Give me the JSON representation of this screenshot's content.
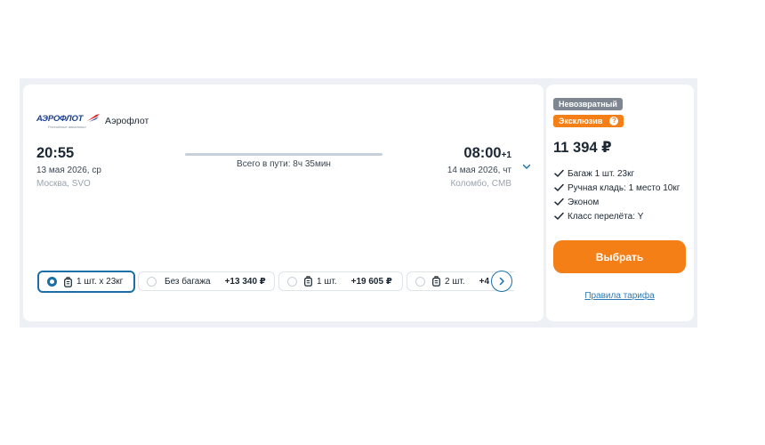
{
  "flight": {
    "logo_text": "АЭРОФЛОТ",
    "logo_subtext": "Российские авиалинии",
    "airline_name": "Аэрофлот",
    "departure": {
      "time": "20:55",
      "date": "13 мая 2026, ср",
      "place": "Москва, SVO"
    },
    "duration": "Всего в пути: 8ч 35мин",
    "arrival": {
      "time": "08:00",
      "day_offset": "+1",
      "date": "14 мая 2026, чт",
      "place": "Коломбо, CMB"
    }
  },
  "baggage_options": [
    {
      "label": "1 шт. x 23кг",
      "price": "",
      "icon": "suitcase-icon",
      "selected": true
    },
    {
      "label": "Без багажа",
      "price": "+13 340 ₽",
      "icon": "",
      "selected": false
    },
    {
      "label": "1 шт.",
      "price": "+19 605 ₽",
      "icon": "suitcase-icon",
      "selected": false
    },
    {
      "label": "2 шт.",
      "price": "+4",
      "icon": "suitcase-icon",
      "selected": false
    }
  ],
  "fare": {
    "badge_nonrefundable": "Невозвратный",
    "badge_exclusive": "Эксклюзив",
    "help_glyph": "?",
    "price": "11 394 ₽",
    "features": [
      "Багаж 1 шт. 23кг",
      "Ручная кладь: 1 место 10кг",
      "Эконом",
      "Класс перелёта: Y"
    ],
    "select_button": "Выбрать",
    "rules_link": "Правила тарифа"
  },
  "colors": {
    "accent_orange": "#f57f17",
    "accent_blue": "#1a6fa8",
    "badge_grey": "#7e8791",
    "link": "#2a7ab8"
  }
}
